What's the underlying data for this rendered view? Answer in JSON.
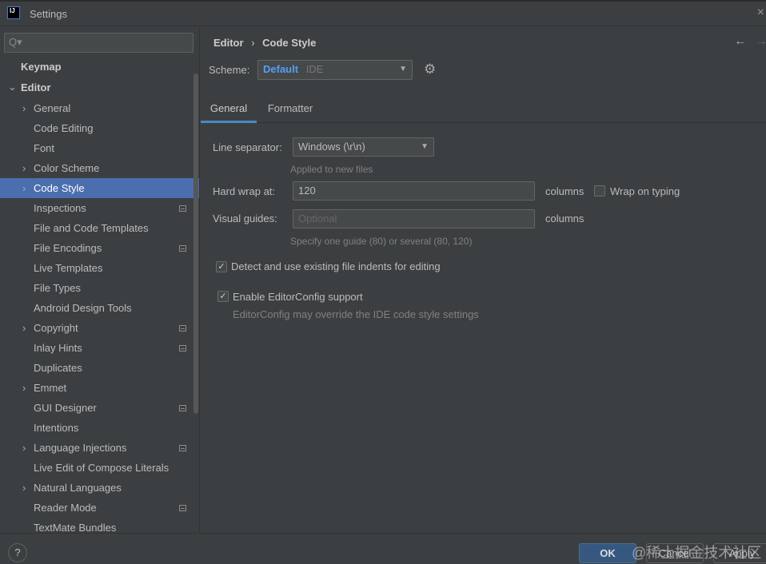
{
  "window": {
    "title": "Settings",
    "logo": "IJ",
    "close_icon": "×"
  },
  "sidebar": {
    "search_icon": "Q▾",
    "keymap": "Keymap",
    "editor": "Editor",
    "items": [
      {
        "label": "General",
        "arrow": true,
        "icon": false
      },
      {
        "label": "Code Editing",
        "arrow": false,
        "icon": false
      },
      {
        "label": "Font",
        "arrow": false,
        "icon": false
      },
      {
        "label": "Color Scheme",
        "arrow": true,
        "icon": false
      },
      {
        "label": "Code Style",
        "arrow": true,
        "icon": false,
        "selected": true
      },
      {
        "label": "Inspections",
        "arrow": false,
        "icon": true
      },
      {
        "label": "File and Code Templates",
        "arrow": false,
        "icon": false
      },
      {
        "label": "File Encodings",
        "arrow": false,
        "icon": true
      },
      {
        "label": "Live Templates",
        "arrow": false,
        "icon": false
      },
      {
        "label": "File Types",
        "arrow": false,
        "icon": false
      },
      {
        "label": "Android Design Tools",
        "arrow": false,
        "icon": false
      },
      {
        "label": "Copyright",
        "arrow": true,
        "icon": true
      },
      {
        "label": "Inlay Hints",
        "arrow": false,
        "icon": true
      },
      {
        "label": "Duplicates",
        "arrow": false,
        "icon": false
      },
      {
        "label": "Emmet",
        "arrow": true,
        "icon": false
      },
      {
        "label": "GUI Designer",
        "arrow": false,
        "icon": true
      },
      {
        "label": "Intentions",
        "arrow": false,
        "icon": false
      },
      {
        "label": "Language Injections",
        "arrow": true,
        "icon": true
      },
      {
        "label": "Live Edit of Compose Literals",
        "arrow": false,
        "icon": false
      },
      {
        "label": "Natural Languages",
        "arrow": true,
        "icon": false
      },
      {
        "label": "Reader Mode",
        "arrow": false,
        "icon": true
      },
      {
        "label": "TextMate Bundles",
        "arrow": false,
        "icon": false
      }
    ]
  },
  "main": {
    "breadcrumb": [
      "Editor",
      "Code Style"
    ],
    "breadcrumb_sep": "›",
    "back": "←",
    "forward": "→",
    "scheme_label": "Scheme:",
    "scheme_name": "Default",
    "scheme_type": "IDE",
    "gear": "⚙",
    "tabs": [
      "General",
      "Formatter"
    ],
    "line_sep_label": "Line separator:",
    "line_sep_value": "Windows (\\r\\n)",
    "line_sep_hint": "Applied to new files",
    "hard_wrap_label": "Hard wrap at:",
    "hard_wrap_value": "120",
    "columns": "columns",
    "wrap_typing": "Wrap on typing",
    "visual_guides_label": "Visual guides:",
    "visual_guides_placeholder": "Optional",
    "visual_guides_hint": "Specify one guide (80) or several (80, 120)",
    "detect_indents": "Detect and use existing file indents for editing",
    "editorconfig": "Enable EditorConfig support",
    "editorconfig_hint": "EditorConfig may override the IDE code style settings"
  },
  "footer": {
    "help": "?",
    "ok": "OK",
    "cancel": "Cancel",
    "apply": "Apply",
    "watermark": "@稀土掘金技术社区"
  }
}
